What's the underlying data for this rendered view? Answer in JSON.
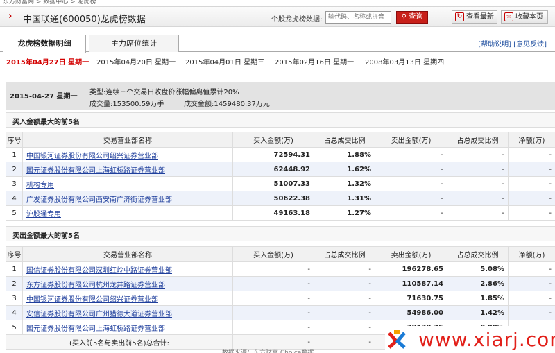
{
  "breadcrumb": "东方财富网 > 数据中心 > 龙虎榜",
  "header": {
    "title": "中国联通(600050)龙虎榜数据",
    "search_label": "个股龙虎榜数据:",
    "search_placeholder": "输代码、名称或拼音",
    "query_button": "查询",
    "latest_button": "查看最新",
    "bookmark_button": "收藏本页"
  },
  "tabs": [
    "龙虎榜数据明细",
    "主力席位统计"
  ],
  "help_links": "[帮助说明] [意见反馈]",
  "dates": [
    "2015年04月27日 星期一",
    "2015年04月20日 星期一",
    "2015年04月01日 星期三",
    "2015年02月16日 星期一",
    "2008年03月13日 星期四"
  ],
  "summary": {
    "date": "2015-04-27 星期一",
    "type": "类型:连续三个交易日收盘价涨幅偏离值累计20%",
    "volume": "成交量:153500.59万手",
    "amount": "成交金额:1459480.37万元"
  },
  "buy_section": {
    "title": "买入金额最大的前5名",
    "headers": [
      "序号",
      "交易营业部名称",
      "买入金额(万)",
      "占总成交比例",
      "卖出金额(万)",
      "占总成交比例",
      "净额(万)"
    ],
    "rows": [
      [
        "1",
        "中国银河证券股份有限公司绍兴证券营业部",
        "72594.31",
        "1.88%",
        "-",
        "-",
        "-"
      ],
      [
        "2",
        "国元证券股份有限公司上海虹桥路证券营业部",
        "62448.92",
        "1.62%",
        "-",
        "-",
        "-"
      ],
      [
        "3",
        "机构专用",
        "51007.33",
        "1.32%",
        "-",
        "-",
        "-"
      ],
      [
        "4",
        "广发证券股份有限公司西安南广济街证券营业部",
        "50622.38",
        "1.31%",
        "-",
        "-",
        "-"
      ],
      [
        "5",
        "沪股通专用",
        "49163.18",
        "1.27%",
        "-",
        "-",
        "-"
      ]
    ]
  },
  "sell_section": {
    "title": "卖出金额最大的前5名",
    "headers": [
      "序号",
      "交易营业部名称",
      "买入金额(万)",
      "占总成交比例",
      "卖出金额(万)",
      "占总成交比例",
      "净额(万)"
    ],
    "rows": [
      [
        "1",
        "国信证券股份有限公司深圳红岭中路证券营业部",
        "-",
        "-",
        "196278.65",
        "5.08%",
        "-"
      ],
      [
        "2",
        "东方证券股份有限公司杭州龙井路证券营业部",
        "-",
        "-",
        "110587.14",
        "2.86%",
        "-"
      ],
      [
        "3",
        "中国银河证券股份有限公司绍兴证券营业部",
        "-",
        "-",
        "71630.75",
        "1.85%",
        "-"
      ],
      [
        "4",
        "安信证券股份有限公司广州猎德大道证券营业部",
        "-",
        "-",
        "54986.00",
        "1.42%",
        "-"
      ],
      [
        "5",
        "国元证券股份有限公司上海虹桥路证券营业部",
        "-",
        "-",
        "38128.75",
        "0.99%",
        "-"
      ]
    ],
    "total_label": "(买入前5名与卖出前5名)总合计:",
    "total_values": [
      "-",
      "-",
      "",
      "",
      ""
    ]
  },
  "watermark": "www.xiarj.com",
  "footer_cut": "数据来源：东方财富 Choice数据"
}
